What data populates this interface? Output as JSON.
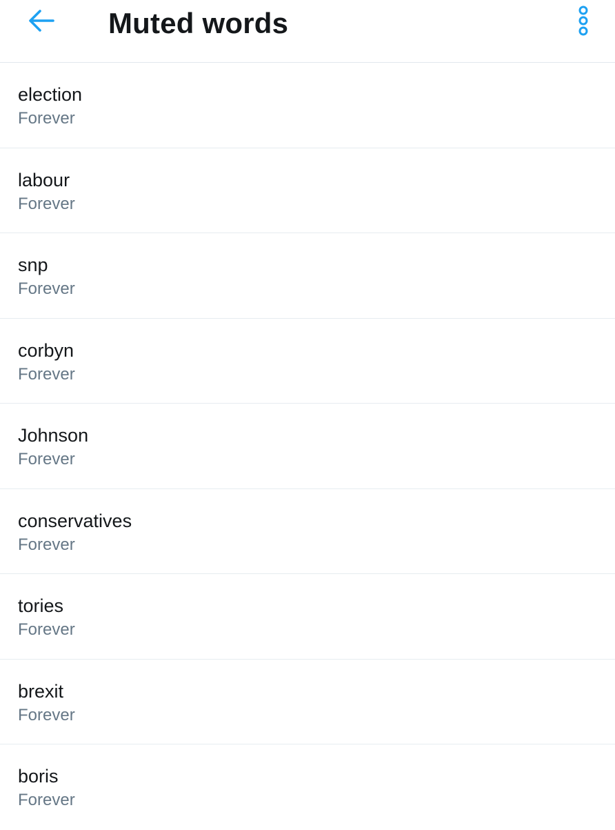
{
  "header": {
    "title": "Muted words",
    "back_icon": "arrow-left-icon",
    "overflow_icon": "more-vertical-icon",
    "accent_color": "#1da1f2"
  },
  "muted_words": [
    {
      "word": "election",
      "duration": "Forever"
    },
    {
      "word": "labour",
      "duration": "Forever"
    },
    {
      "word": "snp",
      "duration": "Forever"
    },
    {
      "word": "corbyn",
      "duration": "Forever"
    },
    {
      "word": "Johnson",
      "duration": "Forever"
    },
    {
      "word": "conservatives",
      "duration": "Forever"
    },
    {
      "word": "tories",
      "duration": "Forever"
    },
    {
      "word": "brexit",
      "duration": "Forever"
    },
    {
      "word": "boris",
      "duration": "Forever"
    }
  ]
}
